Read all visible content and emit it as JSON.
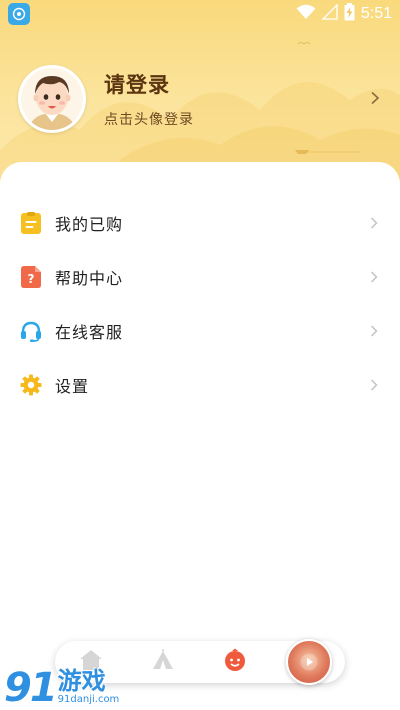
{
  "status_bar": {
    "time": "5:51",
    "icons": [
      "app-badge-icon",
      "wifi-icon",
      "cell-signal-icon",
      "battery-charging-icon"
    ]
  },
  "profile": {
    "title": "请登录",
    "subtitle": "点击头像登录",
    "avatar_icon": "avatar-cartoon-boy-icon",
    "chevron_icon": "chevron-right-icon"
  },
  "menu": {
    "items": [
      {
        "label": "我的已购",
        "icon": "purchased-list-icon",
        "icon_color": "#f6c020"
      },
      {
        "label": "帮助中心",
        "icon": "help-document-icon",
        "icon_color": "#f06a4a"
      },
      {
        "label": "在线客服",
        "icon": "headset-icon",
        "icon_color": "#2aa7e8"
      },
      {
        "label": "设置",
        "icon": "gear-icon",
        "icon_color": "#f6b91c"
      }
    ]
  },
  "tabbar": {
    "tabs": [
      {
        "icon": "home-icon",
        "selected": false
      },
      {
        "icon": "tent-icon",
        "selected": false
      },
      {
        "icon": "profile-face-icon",
        "selected": true
      },
      {
        "icon": "now-playing-icon",
        "selected": false
      }
    ],
    "active_color": "#ef5a3c",
    "inactive_color": "#d6d6d6"
  },
  "watermark": {
    "logo": "91",
    "brand": "游戏",
    "url": "91danji.com"
  },
  "colors": {
    "header_gradient_top": "#f9d97c",
    "title_brown": "#5b3510",
    "chevron_gray": "#c4c4c4"
  }
}
